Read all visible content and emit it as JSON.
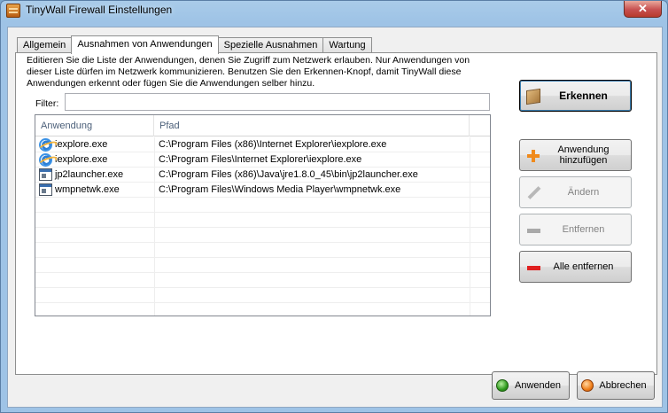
{
  "window": {
    "title": "TinyWall Firewall Einstellungen",
    "close_glyph": "✕"
  },
  "tabs": [
    {
      "label": "Allgemein",
      "active": false
    },
    {
      "label": "Ausnahmen von Anwendungen",
      "active": true
    },
    {
      "label": "Spezielle Ausnahmen",
      "active": false
    },
    {
      "label": "Wartung",
      "active": false
    }
  ],
  "panel": {
    "description": "Editieren Sie die Liste der Anwendungen, denen Sie Zugriff zum Netzwerk erlauben. Nur Anwendungen von dieser Liste dürfen im Netzwerk kommunizieren. Benutzen Sie den Erkennen-Knopf, damit TinyWall diese Anwendungen erkennt oder fügen Sie die Anwendungen selber hinzu.",
    "filter_label": "Filter:",
    "filter_value": ""
  },
  "list": {
    "columns": [
      "Anwendung",
      "Pfad"
    ],
    "rows": [
      {
        "icon": "internet-explorer-icon",
        "name": "iexplore.exe",
        "path": "C:\\Program Files (x86)\\Internet Explorer\\iexplore.exe"
      },
      {
        "icon": "internet-explorer-icon",
        "name": "iexplore.exe",
        "path": "C:\\Program Files\\Internet Explorer\\iexplore.exe"
      },
      {
        "icon": "application-icon",
        "name": "jp2launcher.exe",
        "path": "C:\\Program Files (x86)\\Java\\jre1.8.0_45\\bin\\jp2launcher.exe"
      },
      {
        "icon": "application-icon",
        "name": "wmpnetwk.exe",
        "path": "C:\\Program Files\\Windows Media Player\\wmpnetwk.exe"
      }
    ]
  },
  "side_buttons": {
    "detect": "Erkennen",
    "add": "Anwendung hinzufügen",
    "modify": "Ändern",
    "remove": "Entfernen",
    "remove_all": "Alle entfernen"
  },
  "footer": {
    "apply": "Anwenden",
    "cancel": "Abbrechen"
  },
  "colors": {
    "accent_orange": "#f08a1c",
    "remove_red": "#e02020",
    "apply_green": "#2f9a1d"
  }
}
